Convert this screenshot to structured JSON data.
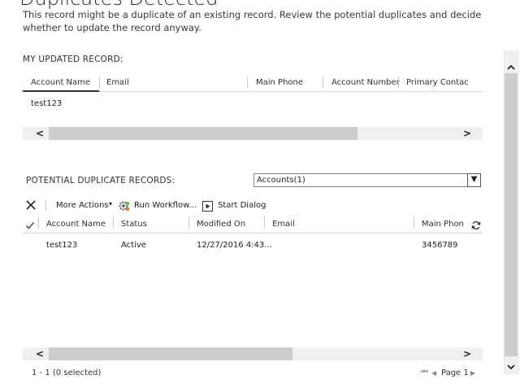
{
  "dialog": {
    "title": "Duplicates Detected",
    "description": "This record might be a duplicate of an existing record. Review the potential duplicates and decide whether to update the record anyway."
  },
  "updated_record": {
    "label": "MY UPDATED RECORD:",
    "columns": [
      "Account Name",
      "Email",
      "Main Phone",
      "Account Number",
      "Primary Contac"
    ],
    "rows": [
      {
        "account_name": "test123"
      }
    ]
  },
  "duplicates": {
    "label": "POTENTIAL DUPLICATE RECORDS:",
    "select_value": "Accounts(1)",
    "toolbar": {
      "more_actions": "More Actions",
      "run_workflow": "Run Workflow...",
      "start_dialog": "Start Dialog"
    },
    "columns": [
      "Account Name",
      "Status",
      "Modified On",
      "Email",
      "Main Phon"
    ],
    "rows": [
      {
        "account_name": "test123",
        "status": "Active",
        "modified_on": "12/27/2016 4:43...",
        "email": "",
        "main_phone": "3456789"
      }
    ]
  },
  "footer": {
    "count": "1 - 1 (0 selected)",
    "page": "Page 1"
  },
  "icons": {
    "first_page": "⏮",
    "prev_page": "◀",
    "next_page": "▶"
  }
}
